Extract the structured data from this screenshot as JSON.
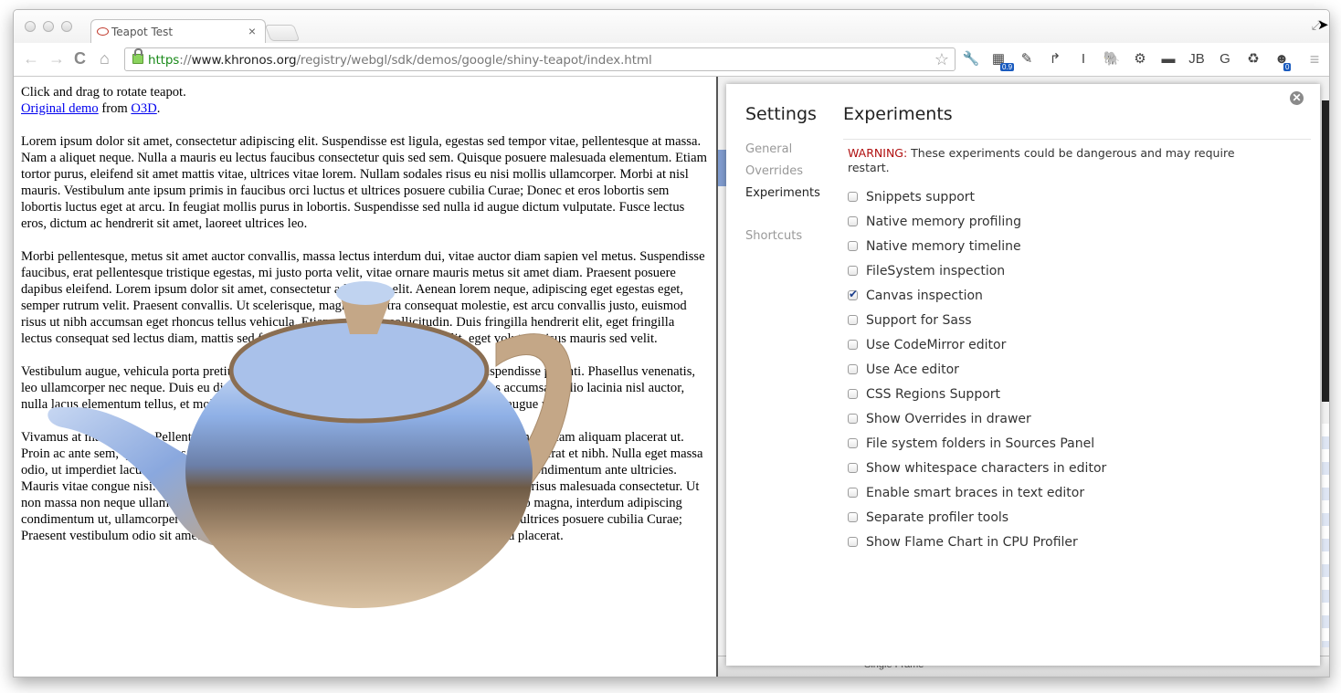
{
  "browser": {
    "tab": {
      "title": "Teapot Test",
      "close_label": "×"
    },
    "url": {
      "scheme": "https",
      "sep": "://",
      "host": "www.khronos.org",
      "path": "/registry/webgl/sdk/demos/google/shiny-teapot/index.html"
    },
    "nav": {
      "back": "←",
      "forward": "→",
      "reload": "C",
      "home": "⌂"
    },
    "star": "☆",
    "fullscreen": "⤢",
    "extensions": [
      {
        "name": "color-picker-icon",
        "glyph": "▦",
        "badge": "0.9"
      },
      {
        "name": "notepad-icon",
        "glyph": "✎"
      },
      {
        "name": "share-icon",
        "glyph": "↱"
      },
      {
        "name": "instapaper-icon",
        "glyph": "I"
      },
      {
        "name": "evernote-icon",
        "glyph": "🐘"
      },
      {
        "name": "gear-icon",
        "glyph": "⚙"
      },
      {
        "name": "mask-icon",
        "glyph": "▬"
      },
      {
        "name": "jb-icon",
        "glyph": "JB"
      },
      {
        "name": "g-icon",
        "glyph": "G"
      },
      {
        "name": "recycle-icon",
        "glyph": "♻"
      },
      {
        "name": "octocat-icon",
        "glyph": "☻",
        "badge": "0"
      }
    ],
    "menu": "≡"
  },
  "page": {
    "intro": "Click and drag to rotate teapot.",
    "link1": "Original demo",
    "from": " from ",
    "link2": "O3D",
    "period": ".",
    "paragraphs": [
      "Lorem ipsum dolor sit amet, consectetur adipiscing elit. Suspendisse est ligula, egestas sed tempor vitae, pellentesque at massa. Nam a aliquet neque. Nulla a mauris eu lectus faucibus consectetur quis sed sem. Quisque posuere malesuada elementum. Etiam tortor purus, eleifend sit amet mattis vitae, ultrices vitae lorem. Nullam sodales risus eu nisi mollis ullamcorper. Morbi at nisl mauris. Vestibulum ante ipsum primis in faucibus orci luctus et ultrices posuere cubilia Curae; Donec et eros lobortis sem lobortis luctus eget at arcu. In feugiat mollis purus in lobortis. Suspendisse sed nulla id augue dictum vulputate. Fusce lectus eros, dictum ac hendrerit sit amet, laoreet ultrices leo.",
      "Morbi pellentesque, metus sit amet auctor convallis, massa lectus interdum dui, vitae auctor diam sapien vel metus. Suspendisse faucibus, erat pellentesque tristique egestas, mi justo porta velit, vitae ornare mauris metus sit amet diam. Praesent posuere dapibus eleifend. Lorem ipsum dolor sit amet, consectetur adipiscing elit. Aenean lorem neque, adipiscing eget egestas eget, semper rutrum velit. Praesent convallis. Ut scelerisque, magna pharetra consequat molestie, est arcu convallis justo, euismod risus ut nibh accumsan eget rhoncus tellus vehicula. Etiam vulputate sollicitudin. Duis fringilla hendrerit elit, eget fringilla lectus consequat sed lectus diam, mattis sed feugiat eget, ullamcorper et velit. velit, eget volutpat risus mauris sed velit.",
      "Vestibulum augue, vehicula porta pretium. In hac habitasse platea dictumst. Praesent Suspendisse potenti. Phasellus venenatis, leo ullamcorper nec neque. Duis eu dignissim nisi. Nullam mollis aliquet purus. Phasellus accumsan odio lacinia nisl auctor, nulla lacus elementum tellus, et mollis nibh sapien eget fermentum quam consequat. Proin augue mi.",
      "Vivamus at mauris velit. Pellentesque lectus, quis accumsan libero. Ut sit amet odio tortor. Donec ullam aliquam placerat ut. Proin ac ante sem, quis egestas mi. Sed ultricies laoreet elit nec tellus magna nec congue non, placerat et nibh. Nulla eget massa odio, ut imperdiet lacus. Sed venenatis faucibus. Vivamus mattis diam sagittis risus volutpat at condimentum ante ultricies. Mauris vitae congue nisi. Aliquam erat volutpat. Curabitur faucibus gravida turpis, vel eleifend risus malesuada consectetur. Ut non massa non neque ullamcorper euismod. Sed dictum leo eu mi egestas tincidunt. Nullam leo magna, interdum adipiscing condimentum ut, ullamcorper id erat. Vestibulum ante ipsum primis in faucibus orci luctus et ultrices posuere cubilia Curae; Praesent vestibulum odio sit amet nunc interdum sagittis. Maecenas egestas sodales felis sed placerat."
    ]
  },
  "devtools": {
    "statusbar": {
      "frame_select": "Single Frame"
    },
    "settings": {
      "title": "Settings",
      "nav": [
        {
          "label": "General",
          "active": false
        },
        {
          "label": "Overrides",
          "active": false
        },
        {
          "label": "Experiments",
          "active": true
        },
        {
          "label": "Shortcuts",
          "active": false
        }
      ],
      "panel_title": "Experiments",
      "warning_label": "WARNING:",
      "warning_text": " These experiments could be dangerous and may require restart.",
      "close": "✕",
      "experiments": [
        {
          "label": "Snippets support",
          "checked": false
        },
        {
          "label": "Native memory profiling",
          "checked": false
        },
        {
          "label": "Native memory timeline",
          "checked": false
        },
        {
          "label": "FileSystem inspection",
          "checked": false
        },
        {
          "label": "Canvas inspection",
          "checked": true
        },
        {
          "label": "Support for Sass",
          "checked": false
        },
        {
          "label": "Use CodeMirror editor",
          "checked": false
        },
        {
          "label": "Use Ace editor",
          "checked": false
        },
        {
          "label": "CSS Regions Support",
          "checked": false
        },
        {
          "label": "Show Overrides in drawer",
          "checked": false
        },
        {
          "label": "File system folders in Sources Panel",
          "checked": false
        },
        {
          "label": "Show whitespace characters in editor",
          "checked": false
        },
        {
          "label": "Enable smart braces in text editor",
          "checked": false
        },
        {
          "label": "Separate profiler tools",
          "checked": false
        },
        {
          "label": "Show Flame Chart in CPU Profiler",
          "checked": false
        }
      ]
    }
  },
  "colors": {
    "link": "#0000ee",
    "warning": "#b01010",
    "url_scheme": "#1a8a1a"
  }
}
